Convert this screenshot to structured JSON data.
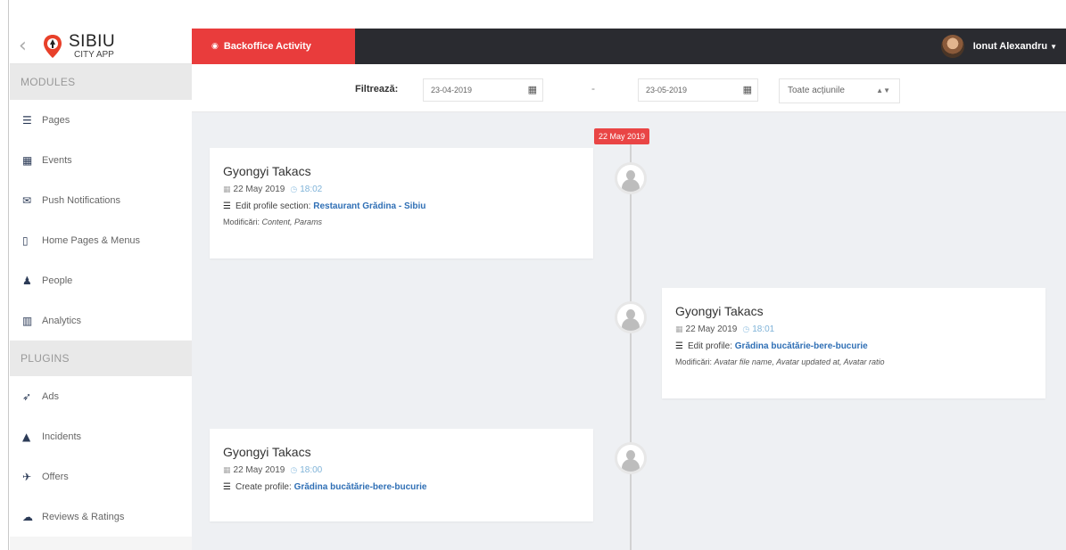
{
  "app": {
    "logo_main": "SIBIU",
    "logo_sub": "CITY APP",
    "active_tab": "Backoffice Activity",
    "user_name": "Ionut Alexandru"
  },
  "sidebar": {
    "modules_title": "MODULES",
    "modules": [
      {
        "label": "Pages",
        "icon": "list-icon"
      },
      {
        "label": "Events",
        "icon": "calendar-icon"
      },
      {
        "label": "Push Notifications",
        "icon": "envelope-icon"
      },
      {
        "label": "Home Pages & Menus",
        "icon": "mobile-icon"
      },
      {
        "label": "People",
        "icon": "user-icon"
      },
      {
        "label": "Analytics",
        "icon": "bar-chart-icon"
      }
    ],
    "plugins_title": "PLUGINS",
    "plugins": [
      {
        "label": "Ads",
        "icon": "rocket-icon"
      },
      {
        "label": "Incidents",
        "icon": "warning-icon"
      },
      {
        "label": "Offers",
        "icon": "plane-icon"
      },
      {
        "label": "Reviews & Ratings",
        "icon": "comment-icon"
      }
    ]
  },
  "filter": {
    "label": "Filtrează:",
    "from_date": "23-04-2019",
    "separator": "-",
    "to_date": "23-05-2019",
    "action_select": "Toate acțiunile"
  },
  "timeline": {
    "date_badge": "22 May 2019",
    "entries": [
      {
        "user": "Gyongyi Takacs",
        "date": "22 May 2019",
        "time": "18:02",
        "action": "Edit profile section:",
        "target": "Restaurant Grădina - Sibiu",
        "mod_label": "Modificări:",
        "mod_value": "Content, Params"
      },
      {
        "user": "Gyongyi Takacs",
        "date": "22 May 2019",
        "time": "18:01",
        "action": "Edit profile:",
        "target": "Grădina bucătărie-bere-bucurie",
        "mod_label": "Modificări:",
        "mod_value": "Avatar file name, Avatar updated at, Avatar ratio"
      },
      {
        "user": "Gyongyi Takacs",
        "date": "22 May 2019",
        "time": "18:00",
        "action": "Create profile:",
        "target": "Grădina bucătărie-bere-bucurie"
      }
    ]
  }
}
